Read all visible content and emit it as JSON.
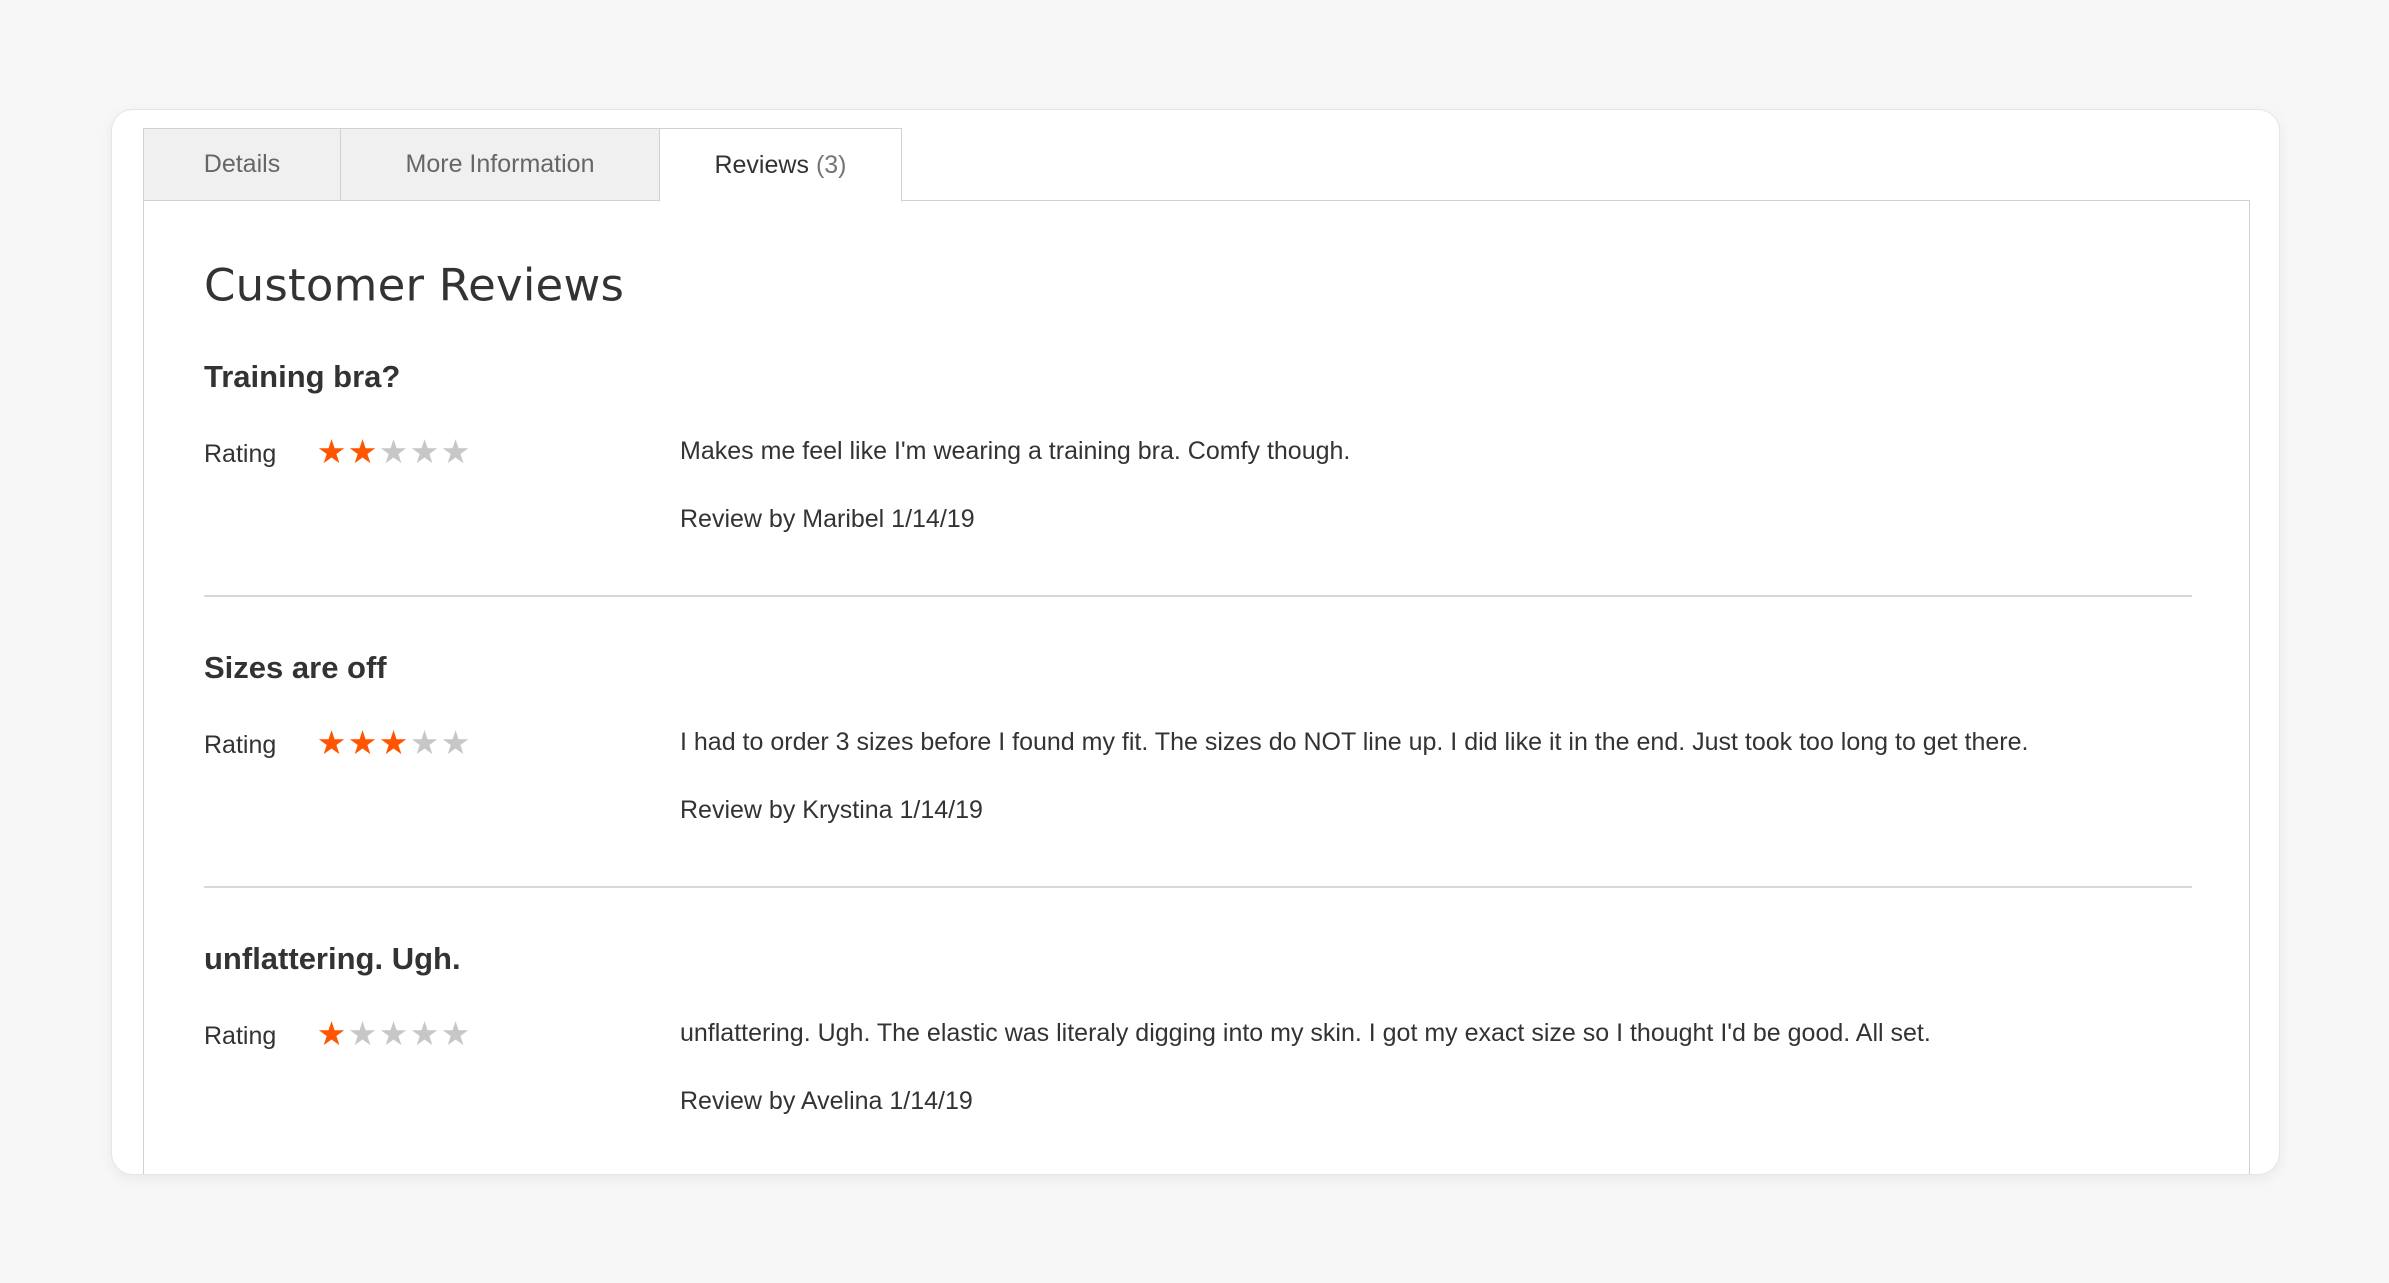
{
  "tabs": [
    {
      "label": "Details",
      "count": ""
    },
    {
      "label": "More Information",
      "count": ""
    },
    {
      "label": "Reviews",
      "count": "(3)"
    }
  ],
  "active_tab": "Reviews",
  "panel": {
    "title": "Customer Reviews"
  },
  "colors": {
    "star_active": "#ff5501",
    "star_inactive": "#c7c7c7"
  },
  "reviews": [
    {
      "title": "Training bra?",
      "rating_label": "Rating",
      "rating": 2,
      "rating_max": 5,
      "text": "Makes me feel like I'm wearing a training bra. Comfy though.",
      "author": "Review by Maribel 1/14/19"
    },
    {
      "title": "Sizes are off",
      "rating_label": "Rating",
      "rating": 3,
      "rating_max": 5,
      "text": "I had to order 3 sizes before I found my fit. The sizes do NOT line up. I did like it in the end. Just took too long to get there.",
      "author": "Review by Krystina 1/14/19"
    },
    {
      "title": "unflattering. Ugh.",
      "rating_label": "Rating",
      "rating": 1,
      "rating_max": 5,
      "text": "unflattering. Ugh. The elastic was literaly digging into my skin. I got my exact size so I thought I'd be good. All set.",
      "author": "Review by Avelina 1/14/19"
    }
  ]
}
